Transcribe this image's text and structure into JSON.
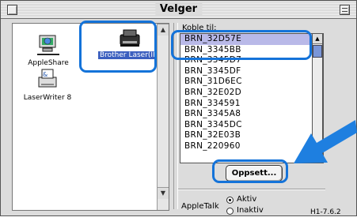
{
  "window": {
    "title": "Velger"
  },
  "left_panel": {
    "items": [
      {
        "label": "AppleShare",
        "icon": "appleshare-icon",
        "selected": false
      },
      {
        "label": "Brother Laser(IP)",
        "icon": "printer-icon",
        "selected": true
      },
      {
        "label": "LaserWriter 8",
        "icon": "laserwriter-icon",
        "selected": false
      }
    ]
  },
  "right_panel": {
    "connect_label": "Koble til:",
    "printers": [
      "BRN_32D57E",
      "BRN_3345BB",
      "BRN_3345D7",
      "BRN_3345DF",
      "BRN_31D6EC",
      "BRN_32E02D",
      "BRN_334591",
      "BRN_3345A8",
      "BRN_3345DC",
      "BRN_32E03B",
      "BRN_220960"
    ],
    "selected_index": 0,
    "setup_button": "Oppsett...",
    "appletalk_label": "AppleTalk",
    "appletalk_options": [
      "Aktiv",
      "Inaktiv"
    ],
    "appletalk_selected": "Aktiv",
    "version": "H1-7.6.2"
  },
  "colors": {
    "callout": "#1473d9",
    "selection": "#b9b9e8",
    "arrow": "#1e7fe0"
  }
}
